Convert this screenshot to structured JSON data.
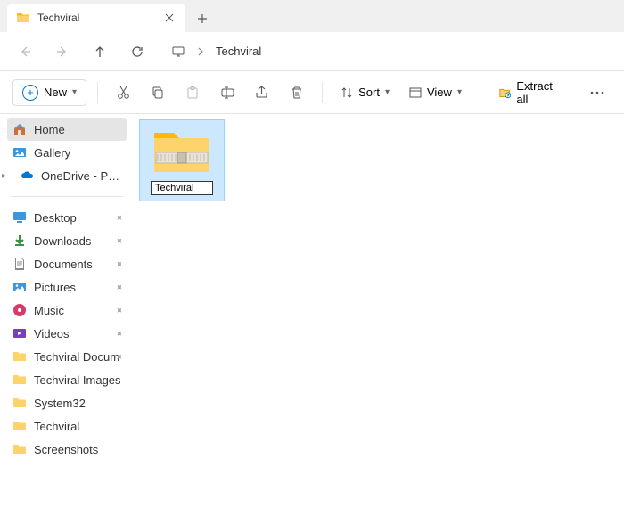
{
  "tab": {
    "title": "Techviral"
  },
  "breadcrumb": {
    "current": "Techviral"
  },
  "toolbar": {
    "new_label": "New",
    "sort_label": "Sort",
    "view_label": "View",
    "extract_label": "Extract all"
  },
  "sidebar": {
    "top": [
      {
        "label": "Home",
        "icon": "home"
      },
      {
        "label": "Gallery",
        "icon": "gallery"
      },
      {
        "label": "OneDrive - Persona",
        "icon": "onedrive",
        "expandable": true
      }
    ],
    "quick": [
      {
        "label": "Desktop",
        "icon": "desktop",
        "pinned": true
      },
      {
        "label": "Downloads",
        "icon": "downloads",
        "pinned": true
      },
      {
        "label": "Documents",
        "icon": "documents",
        "pinned": true
      },
      {
        "label": "Pictures",
        "icon": "pictures",
        "pinned": true
      },
      {
        "label": "Music",
        "icon": "music",
        "pinned": true
      },
      {
        "label": "Videos",
        "icon": "videos",
        "pinned": true
      },
      {
        "label": "Techviral Docum",
        "icon": "folder",
        "pinned": true
      },
      {
        "label": "Techviral Images",
        "icon": "folder",
        "pinned": false
      },
      {
        "label": "System32",
        "icon": "folder",
        "pinned": false
      },
      {
        "label": "Techviral",
        "icon": "folder",
        "pinned": false
      },
      {
        "label": "Screenshots",
        "icon": "folder",
        "pinned": false
      }
    ]
  },
  "content": {
    "items": [
      {
        "name": "Techviral",
        "type": "zip",
        "editing": true
      }
    ]
  }
}
